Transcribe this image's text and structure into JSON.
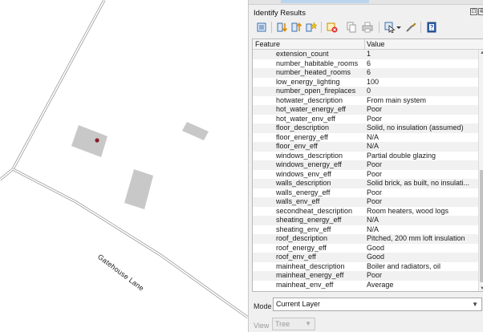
{
  "map": {
    "road_label": "Gatehouse Lane"
  },
  "panel": {
    "title": "Identify Results",
    "title_buttons": [
      "⊡",
      "⊗"
    ],
    "toolbar_icons": [
      "expand-tree-icon",
      "expand-all-icon",
      "collapse-all-icon",
      "expand-new-icon",
      "clear-results-icon",
      "copy-feature-icon",
      "print-icon",
      "identify-select-icon",
      "settings-icon",
      "help-icon"
    ],
    "columns": {
      "feature": "Feature",
      "value": "Value"
    },
    "rows": [
      {
        "k": "extension_count",
        "v": "1"
      },
      {
        "k": "number_habitable_rooms",
        "v": "6"
      },
      {
        "k": "number_heated_rooms",
        "v": "6"
      },
      {
        "k": "low_energy_lighting",
        "v": "100"
      },
      {
        "k": "number_open_fireplaces",
        "v": "0"
      },
      {
        "k": "hotwater_description",
        "v": "From main system"
      },
      {
        "k": "hot_water_energy_eff",
        "v": "Poor"
      },
      {
        "k": "hot_water_env_eff",
        "v": "Poor"
      },
      {
        "k": "floor_description",
        "v": "Solid, no insulation (assumed)"
      },
      {
        "k": "floor_energy_eff",
        "v": "N/A"
      },
      {
        "k": "floor_env_eff",
        "v": "N/A"
      },
      {
        "k": "windows_description",
        "v": "Partial double glazing"
      },
      {
        "k": "windows_energy_eff",
        "v": "Poor"
      },
      {
        "k": "windows_env_eff",
        "v": "Poor"
      },
      {
        "k": "walls_description",
        "v": "Solid brick, as built, no insulati..."
      },
      {
        "k": "walls_energy_eff",
        "v": "Poor"
      },
      {
        "k": "walls_env_eff",
        "v": "Poor"
      },
      {
        "k": "secondheat_description",
        "v": "Room heaters, wood logs"
      },
      {
        "k": "sheating_energy_eff",
        "v": "N/A"
      },
      {
        "k": "sheating_env_eff",
        "v": "N/A"
      },
      {
        "k": "roof_description",
        "v": "Pitched, 200 mm loft insulation"
      },
      {
        "k": "roof_energy_eff",
        "v": "Good"
      },
      {
        "k": "roof_env_eff",
        "v": "Good"
      },
      {
        "k": "mainheat_description",
        "v": "Boiler and radiators, oil"
      },
      {
        "k": "mainheat_energy_eff",
        "v": "Poor"
      },
      {
        "k": "mainheat_env_eff",
        "v": "Average"
      }
    ],
    "mode": {
      "label": "Mode",
      "value": "Current Layer"
    },
    "view": {
      "label": "View",
      "value": "Tree"
    }
  }
}
